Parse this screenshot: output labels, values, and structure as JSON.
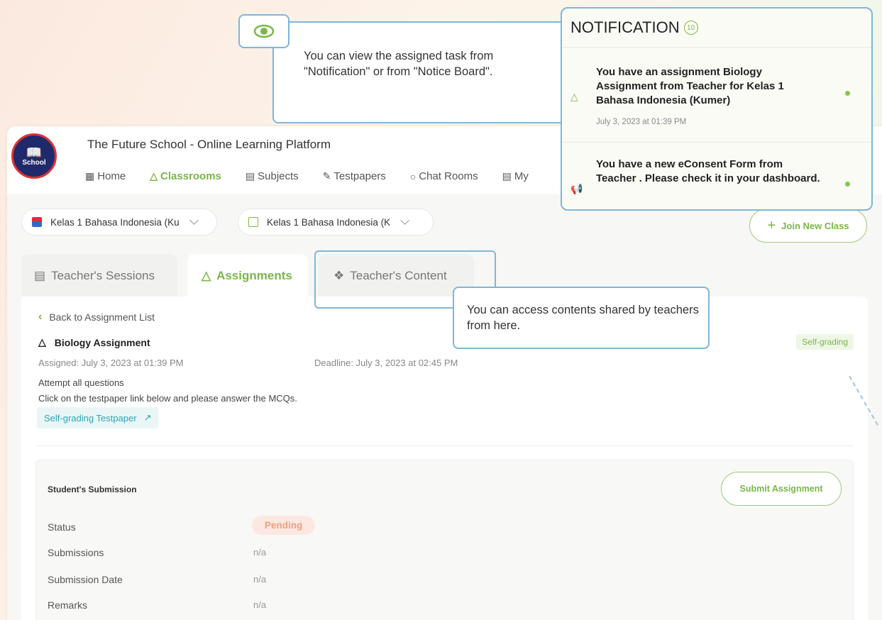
{
  "header": {
    "logo_text": "School",
    "app_title": "The Future School - Online Learning Platform"
  },
  "nav": {
    "items": [
      {
        "label": "Home",
        "icon": "grid-icon"
      },
      {
        "label": "Classrooms",
        "icon": "pen-icon"
      },
      {
        "label": "Subjects",
        "icon": "book-icon"
      },
      {
        "label": "Testpapers",
        "icon": "document-icon"
      },
      {
        "label": "Chat Rooms",
        "icon": "chat-icon"
      },
      {
        "label": "My",
        "icon": "calendar-icon"
      }
    ]
  },
  "selectors": {
    "class1": "Kelas 1 Bahasa Indonesia (Ku",
    "class2": "Kelas 1 Bahasa Indonesia (K"
  },
  "join_button": "Join New Class",
  "tabs": [
    {
      "label": "Teacher's Sessions"
    },
    {
      "label": "Assignments"
    },
    {
      "label": "Teacher's Content"
    }
  ],
  "assignment": {
    "back_label": "Back to Assignment List",
    "title": "Biology Assignment",
    "badge": "Self-grading",
    "assigned": "Assigned: July 3, 2023 at 01:39 PM",
    "deadline": "Deadline: July 3, 2023 at 02:45 PM",
    "instruction1": "Attempt all questions",
    "instruction2": "Click on the testpaper link below and please answer the MCQs.",
    "testpaper_link": "Self-grading Testpaper"
  },
  "submission": {
    "title": "Student's Submission",
    "submit_button": "Submit Assignment",
    "rows": [
      {
        "label": "Status",
        "value": "Pending"
      },
      {
        "label": "Submissions",
        "value": "n/a"
      },
      {
        "label": "Submission Date",
        "value": "n/a"
      },
      {
        "label": "Remarks",
        "value": "n/a"
      }
    ]
  },
  "callouts": {
    "view_task": "You can view the assigned task from \"Notification\" or from \"Notice Board\".",
    "content": "You can access contents shared by teachers from here."
  },
  "notification": {
    "title": "NOTIFICATION",
    "count": "10",
    "items": [
      {
        "text": "You have an assignment Biology Assignment from Teacher for Kelas 1 Bahasa Indonesia (Kumer)",
        "time": "July 3, 2023 at 01:39 PM"
      },
      {
        "text": "You have a new eConsent Form from Teacher . Please check it in your dashboard.",
        "time": ""
      }
    ]
  },
  "colors": {
    "accent_green": "#7ab648",
    "callout_border": "#7fb6d8",
    "pending_bg": "#fde8e1",
    "link_teal": "#2aa6b8"
  }
}
